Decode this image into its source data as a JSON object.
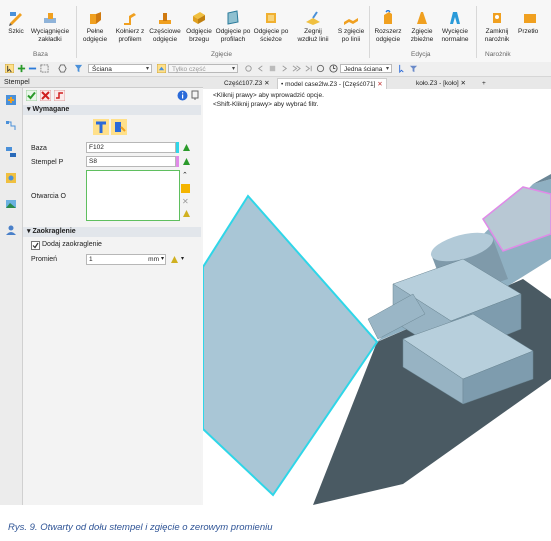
{
  "ribbon": {
    "buttons": [
      {
        "label": "Szkic"
      },
      {
        "label": "Wyciągnięcie zakładki"
      },
      {
        "label": "Pełne odgięcie"
      },
      {
        "label": "Kołnierz z profilem"
      },
      {
        "label": "Częściowe odgięcie"
      },
      {
        "label": "Odgięcie brzegu"
      },
      {
        "label": "Odgięcie po profilach"
      },
      {
        "label": "Odgięcie po ścieżce"
      },
      {
        "label": "Zegnij wzdłuż linii"
      },
      {
        "label": "S zgięcie po linii"
      },
      {
        "label": "Rozszerz odgięcie"
      },
      {
        "label": "Zgięcie zbieżne"
      },
      {
        "label": "Wycięcie normalne"
      },
      {
        "label": "Zamknij narożnik"
      },
      {
        "label": "Przetło"
      }
    ],
    "groups": [
      "Baza",
      "Zgięcie",
      "Edycja",
      "Narożnik"
    ]
  },
  "toolbar2": {
    "face_filter": "Ściana",
    "part_filter": "Tylko część",
    "face_mode": "Jedna ściana"
  },
  "panel": {
    "title": "Stempel",
    "section_required": "Wymagane",
    "baza_label": "Baza",
    "baza_value": "F102",
    "stempel_label": "Stempel P",
    "stempel_value": "S8",
    "otwarcia_label": "Otwarcia O",
    "section_rounding": "Zaokraglenie",
    "add_rounding_label": "Dodaj zaokraglenie",
    "add_rounding_checked": true,
    "radius_label": "Promień",
    "radius_value": "1",
    "radius_unit": "mm"
  },
  "tabs": [
    {
      "label": "Część107.Z3",
      "active": false
    },
    {
      "label": "model case2lw.Z3 - [Część071]",
      "active": true
    },
    {
      "label": "koło.Z3 - [koło]",
      "active": false
    }
  ],
  "hints": [
    "<Kliknij prawy> aby wprowadzić opcje.",
    "<Shift-Kliknij prawy> aby wybrać filtr."
  ],
  "caption": "Rys. 9. Otwarty od dołu stempel i zgięcie o zerowym promieniu",
  "colors": {
    "accent": "#2f5496",
    "highlight_edge": "#2fd6e8",
    "part_face": "#a9c6d6",
    "part_dark": "#4a5a63"
  }
}
